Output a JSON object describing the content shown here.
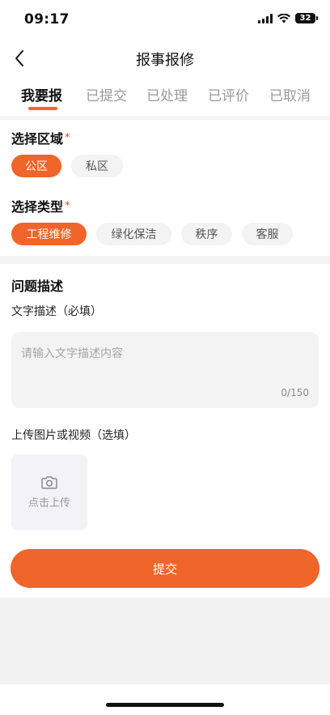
{
  "status_bar": {
    "time": "09:17",
    "battery": "32",
    "icons": [
      "cellular-signal-icon",
      "wifi-icon",
      "battery-icon"
    ]
  },
  "nav": {
    "title": "报事报修",
    "back_icon": "chevron-left-icon"
  },
  "tabs": [
    {
      "label": "我要报",
      "active": true
    },
    {
      "label": "已提交",
      "active": false
    },
    {
      "label": "已处理",
      "active": false
    },
    {
      "label": "已评价",
      "active": false
    },
    {
      "label": "已取消",
      "active": false
    }
  ],
  "area": {
    "title": "选择区域",
    "required_mark": "*",
    "options": [
      {
        "label": "公区",
        "selected": true
      },
      {
        "label": "私区",
        "selected": false
      }
    ]
  },
  "type": {
    "title": "选择类型",
    "required_mark": "*",
    "options": [
      {
        "label": "工程维修",
        "selected": true
      },
      {
        "label": "绿化保洁",
        "selected": false
      },
      {
        "label": "秩序",
        "selected": false
      },
      {
        "label": "客服",
        "selected": false
      }
    ]
  },
  "problem": {
    "title": "问题描述",
    "text_label": "文字描述（必填）",
    "text_placeholder": "请输入文字描述内容",
    "text_value": "",
    "counter": "0/150",
    "upload_label": "上传图片或视频（选填）",
    "upload_text": "点击上传",
    "upload_icon": "camera-icon"
  },
  "submit_label": "提交",
  "colors": {
    "accent": "#f0652a",
    "chip_bg": "#f3f3f4",
    "required": "#e2462b",
    "muted_text": "#9a9a9a",
    "page_gray": "#f2f2f2"
  }
}
